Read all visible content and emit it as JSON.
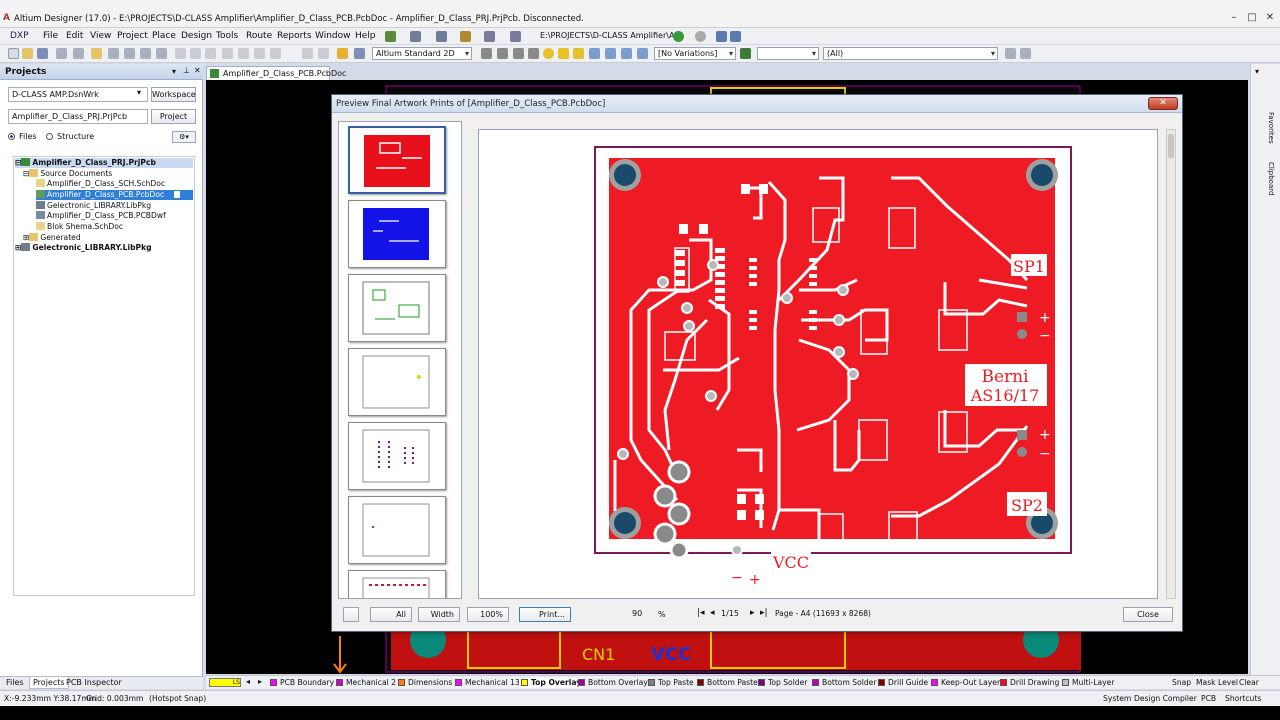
{
  "app": {
    "title": "Altium Designer (17.0) - E:\\PROJECTS\\D-CLASS Amplifier\\Amplifier_D_Class_PCB.PcbDoc - Amplifier_D_Class_PRJ.PrjPcb. Disconnected."
  },
  "menu": [
    "DXP",
    "File",
    "Edit",
    "View",
    "Project",
    "Place",
    "Design",
    "Tools",
    "Route",
    "Reports",
    "Window",
    "Help"
  ],
  "toolbar": {
    "path": "E:\\PROJECTS\\D-CLASS Amplifier\\A",
    "view_mode": "Altium Standard 2D",
    "variations": "[No Variations]",
    "filter": "(All)"
  },
  "projects_panel": {
    "title": "Projects",
    "workspace_value": "D-CLASS AMP.DsnWrk",
    "workspace_button": "Workspace",
    "project_value": "Amplifier_D_Class_PRJ.PrjPcb",
    "project_button": "Project",
    "radio_files": "Files",
    "radio_structure": "Structure",
    "tree": [
      {
        "label": "Amplifier_D_Class_PRJ.PrjPcb",
        "level": 0
      },
      {
        "label": "Source Documents",
        "level": 1
      },
      {
        "label": "Amplifier_D_Class_SCH.SchDoc",
        "level": 2
      },
      {
        "label": "Amplifier_D_Class_PCB.PcbDoc",
        "level": 2
      },
      {
        "label": "Gelectronic_LIBRARY.LibPkg",
        "level": 2
      },
      {
        "label": "Amplifier_D_Class_PCB.PCBDwf",
        "level": 2
      },
      {
        "label": "Blok Shema.SchDoc",
        "level": 2
      },
      {
        "label": "Generated",
        "level": 1
      },
      {
        "label": "Gelectronic_LIBRARY.LibPkg",
        "level": 0
      }
    ],
    "bottom_tabs": [
      "Files",
      "Projects",
      "PCB Inspector"
    ]
  },
  "document_tab": "Amplifier_D_Class_PCB.PcbDoc",
  "dialog": {
    "title": "Preview Final Artwork Prints of [Amplifier_D_Class_PCB.PcbDoc]",
    "close_label": "Close",
    "buttons": {
      "all": "All",
      "width": "Width",
      "zoom100": "100%",
      "print": "Print..."
    },
    "zoom_value": "90",
    "zoom_unit": "%",
    "page_counter": "1/15",
    "page_info": "Page - A4 (11693 x 8268)",
    "board_labels": {
      "sp1": "SP1",
      "sp2": "SP2",
      "berni": "Berni",
      "as": "AS16/17",
      "vcc": "VCC",
      "plus": "+",
      "minus": "−"
    }
  },
  "canvas_behind": {
    "cn1": "CN1",
    "vcc": "VCC"
  },
  "layers": [
    {
      "name": "LS",
      "color": "#ffff00"
    },
    {
      "name": "PCB Boundary",
      "color": "#ff00ff"
    },
    {
      "name": "Mechanical 2",
      "color": "#d000d0"
    },
    {
      "name": "Dimensions",
      "color": "#ff8000"
    },
    {
      "name": "Mechanical 13",
      "color": "#ff00ff"
    },
    {
      "name": "Top Overlay",
      "color": "#ffff00"
    },
    {
      "name": "Bottom Overlay",
      "color": "#a000a0"
    },
    {
      "name": "Top Paste",
      "color": "#808080"
    },
    {
      "name": "Bottom Paste",
      "color": "#800000"
    },
    {
      "name": "Top Solder",
      "color": "#800080"
    },
    {
      "name": "Bottom Solder",
      "color": "#c000c0"
    },
    {
      "name": "Drill Guide",
      "color": "#800000"
    },
    {
      "name": "Keep-Out Layer",
      "color": "#ff00ff"
    },
    {
      "name": "Drill Drawing",
      "color": "#ff002a"
    },
    {
      "name": "Multi-Layer",
      "color": "#c0c0c0"
    }
  ],
  "layer_right": [
    "Snap",
    "Mask Level",
    "Clear"
  ],
  "status": {
    "coords": "X:-9.233mm Y:38.17mm",
    "grid": "Grid: 0.003mm",
    "snap": "(Hotspot Snap)",
    "right_items": [
      "System",
      "Design Compiler",
      "PCB",
      "Shortcuts"
    ]
  },
  "right_strip": [
    "Favorites",
    "Clipboard"
  ]
}
